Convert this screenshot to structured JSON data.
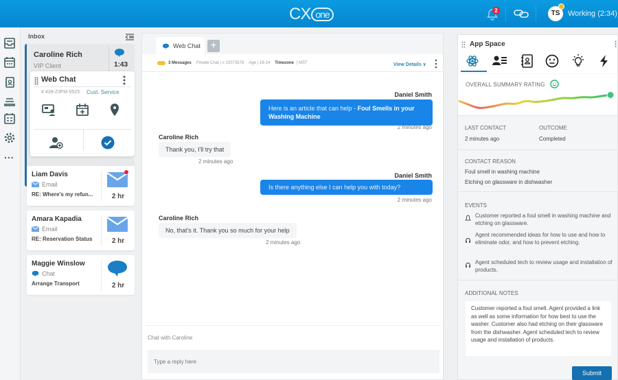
{
  "header": {
    "logo_cx": "CX",
    "logo_one": "one",
    "notification_count": "2",
    "avatar_initials": "TS",
    "agent_status": "Working (2:34)"
  },
  "left_nav": {
    "icons": [
      "inbox-icon",
      "calendar-icon",
      "contacts-icon",
      "queue-icon",
      "schedule-icon",
      "gear-icon",
      "more-icon"
    ],
    "more_label": "..."
  },
  "inbox": {
    "title": "Inbox",
    "active": {
      "name": "Caroline Rich",
      "subtitle": "VIP Client",
      "time": "1:43",
      "card_title": "Web Chat",
      "case_id": "# 439-Z3FM-5523",
      "category": "Cust. Service"
    },
    "items": [
      {
        "name": "Liam Davis",
        "type": "Email",
        "subject": "RE: Where's my refun...",
        "time": "2 hr",
        "unread": true
      },
      {
        "name": "Amara Kapadia",
        "type": "Email",
        "subject": "RE: Reservation Status",
        "time": "2 hr",
        "unread": false
      },
      {
        "name": "Maggie Winslow",
        "type": "Chat",
        "subject": "Arrange Transport",
        "time": "2 hr",
        "unread": false
      }
    ]
  },
  "chat": {
    "tab_label": "Web Chat",
    "add_tab": "+",
    "info": {
      "messages": "3 Messages",
      "private": "Private Chat | # 22073579",
      "age": "Age | 18-24",
      "timezone_label": "Timezone",
      "timezone_value": "| MST",
      "view_details": "View Details ∨"
    },
    "messages": [
      {
        "sender": "Daniel Smith",
        "text_prefix": "Here is an article that can help - ",
        "text_bold": "Foul Smells in your Washing Machine",
        "time": "2 minutes ago",
        "direction": "out"
      },
      {
        "sender": "Caroline Rich",
        "text": "Thank you, I'll try that",
        "time": "2 minutes ago",
        "direction": "in"
      },
      {
        "sender": "Daniel Smith",
        "text": "Is there anything else I can help you with today?",
        "time": "2 minutes ago",
        "direction": "out"
      },
      {
        "sender": "Caroline Rich",
        "text": "No, that's it.  Thank you so much for your help",
        "time": "2 minutes ago",
        "direction": "in"
      }
    ],
    "composer_label": "Chat with Caroline",
    "reply_placeholder": "Type a reply here"
  },
  "app_space": {
    "title": "App Space",
    "tabs": [
      "atom-icon",
      "contact-card-icon",
      "address-book-icon",
      "smiley-icon",
      "lightbulb-icon",
      "lightning-icon"
    ],
    "summary_label": "OVERALL SUMMARY RATING",
    "sentiment_trend": [
      0.55,
      0.38,
      0.2,
      0.25,
      0.34,
      0.45,
      0.4,
      0.58,
      0.5,
      0.55,
      0.62,
      0.72,
      0.68,
      0.76,
      0.72,
      0.8,
      0.85
    ],
    "last_contact_label": "LAST CONTACT",
    "last_contact_value": "2 minutes ago",
    "outcome_label": "OUTCOME",
    "outcome_value": "Completed",
    "contact_reason_label": "CONTACT REASON",
    "contact_reasons": [
      "Foul smell in washing machine",
      "Etching on glassware in dishwasher"
    ],
    "events_label": "EVENTS",
    "events": [
      {
        "icon": "person-icon",
        "text": "Customer reported a foul smell in washing machine and etching on glassware."
      },
      {
        "icon": "headset-icon",
        "text": "Agent recommended ideas for how to use and how to eliminate odor, and how to prevent etching."
      },
      {
        "icon": "headset-icon",
        "text": "Agent scheduled tech to review usage and installation of products."
      }
    ],
    "notes_label": "ADDITIONAL NOTES",
    "notes": "Customer reported a foul smell. Agent provided a link as well as some information for how best to use the washer. Customer also had etching on their glassware from the dishwasher. Agent scheduled tech to review usage and installation of products.",
    "submit_label": "Submit"
  },
  "colors": {
    "header_blue": "#0a9be0",
    "accent_blue": "#1a85e8",
    "active_border": "#2a6da3",
    "teal": "#3f8e97",
    "submit": "#1470b0"
  }
}
